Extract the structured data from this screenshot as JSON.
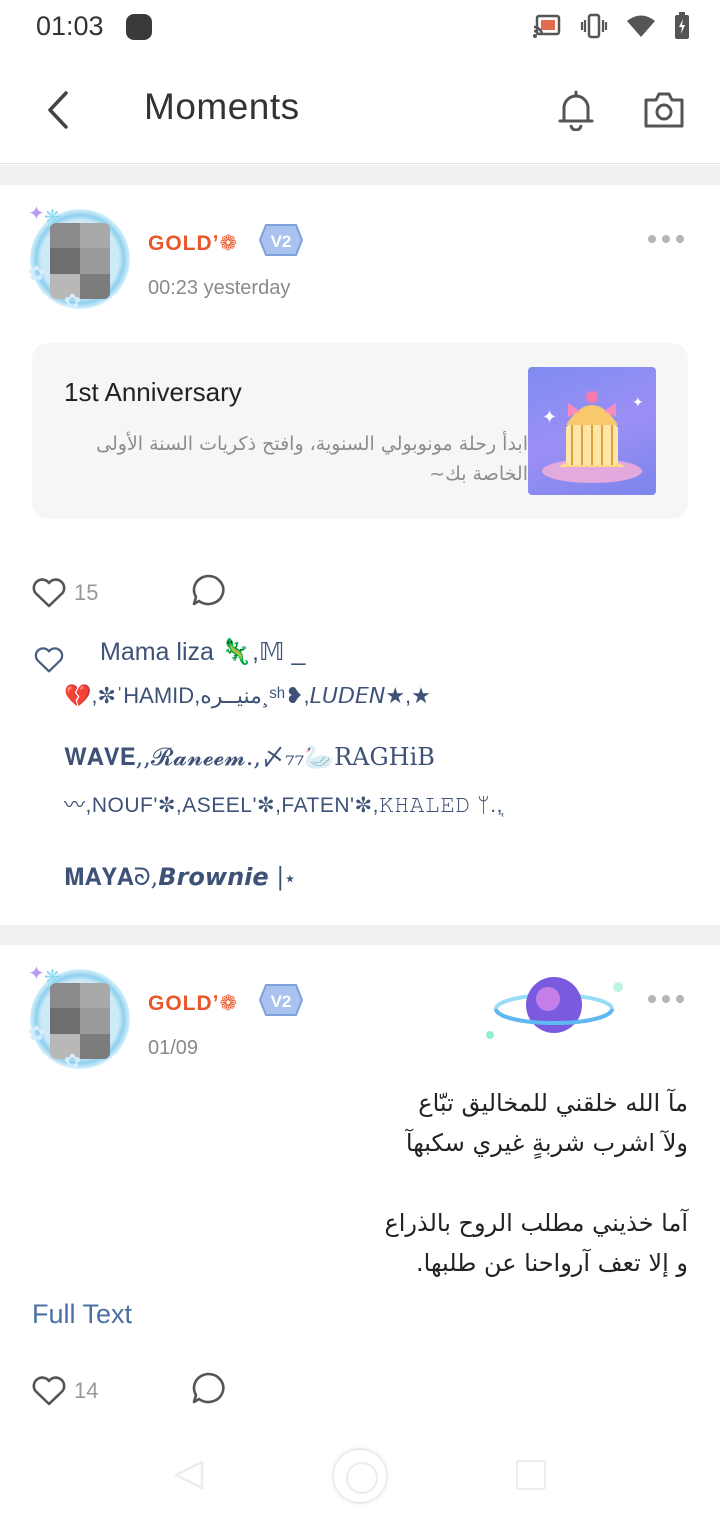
{
  "status_bar": {
    "time": "01:03"
  },
  "header": {
    "title": "Moments"
  },
  "posts": [
    {
      "username": "GOLDʼ❁",
      "vip": "V2",
      "time": "00:23 yesterday",
      "share_card": {
        "title": "1st Anniversary",
        "description": "ابدأ رحلة مونوبولي السنوية، وافتح ذكريات السنة الأولى الخاصة بك~"
      },
      "likes": "15",
      "likers": {
        "line1": "Mama liza 🦎,𝕄 _",
        "line2": "💔,✼ˈHAMID,منيــره¸ˢʰ❥,𝘓𝘜𝘋𝘌𝘕★,★",
        "line3": "𝐖𝐀𝐕𝐄,,𝓡𝓪𝓷𝓮𝓮𝓶.,〆₇₇🦢RAGHiB",
        "line4": "〰,NOUF'✼,ASEEL'✼,FATEN'✼,𝙺𝙷𝙰𝙻𝙴𝙳 ᛘ.,᷂",
        "line5": "𝐌𝐀𝐘𝐀ᘐ,𝘽𝙧𝙤𝙬𝙣𝙞𝙚 |⋆"
      }
    },
    {
      "username": "GOLDʼ❁",
      "vip": "V2",
      "time": "01/09",
      "body": [
        "مآ الله خلقني للمخاليق تبّاع",
        "ولآ اشرب شربةٍ غيري سكبهآ",
        "",
        "آما خذيني مطلب الروح بالذراع",
        "و إلا تعف آرواحنا عن طلبها."
      ],
      "full_text": "Full Text",
      "likes": "14"
    }
  ],
  "colors": {
    "username": "#e8572a",
    "liker_name": "#3e5277",
    "link": "#4c6fa5",
    "divider": "#f0f0f0"
  },
  "icons": [
    "cast-icon",
    "vibrate-icon",
    "wifi-icon",
    "battery-icon",
    "back-arrow-icon",
    "bell-icon",
    "camera-icon",
    "heart-icon",
    "comment-icon",
    "more-icon"
  ]
}
